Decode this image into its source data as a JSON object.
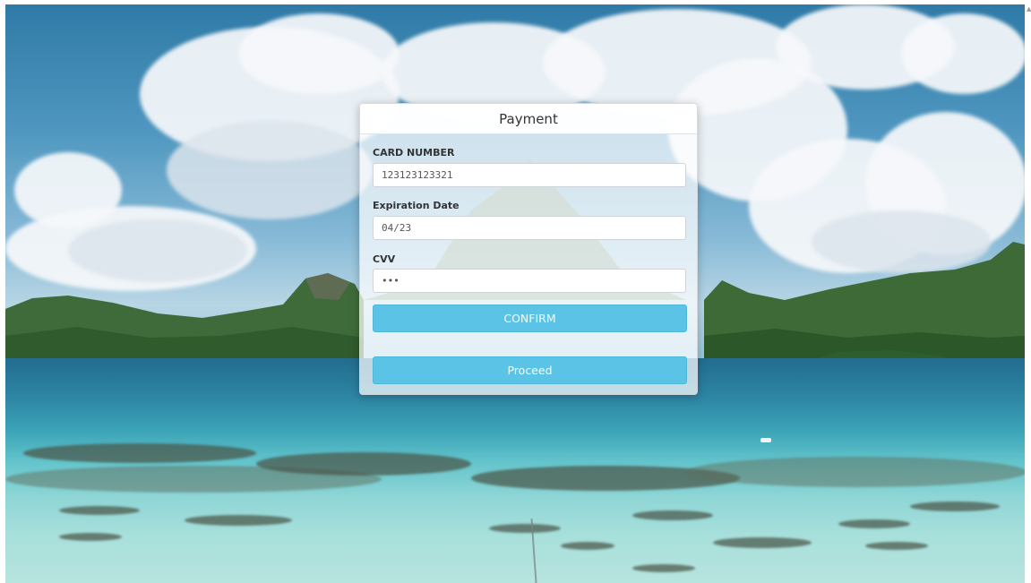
{
  "dialog": {
    "title": "Payment"
  },
  "form": {
    "card_number": {
      "label": "CARD NUMBER",
      "value": "123123123321"
    },
    "expiration_date": {
      "label": "Expiration Date",
      "value": "04/23"
    },
    "cvv": {
      "label": "CVV",
      "value": "•••"
    }
  },
  "actions": {
    "confirm_label": "CONFIRM",
    "proceed_label": "Proceed"
  },
  "colors": {
    "button": "#5bc4e6",
    "button_text": "#f2fbff"
  },
  "icons": {
    "scroll_caret": "scroll-up-caret-icon"
  }
}
